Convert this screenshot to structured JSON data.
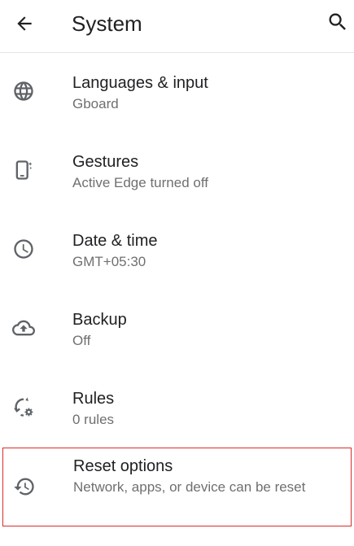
{
  "header": {
    "title": "System",
    "back_icon": "arrow-left-icon",
    "search_icon": "search-icon"
  },
  "items": [
    {
      "title": "Languages & input",
      "subtitle": "Gboard",
      "icon": "globe-icon"
    },
    {
      "title": "Gestures",
      "subtitle": "Active Edge turned off",
      "icon": "phone-gesture-icon"
    },
    {
      "title": "Date & time",
      "subtitle": "GMT+05:30",
      "icon": "clock-icon"
    },
    {
      "title": "Backup",
      "subtitle": "Off",
      "icon": "cloud-upload-icon"
    },
    {
      "title": "Rules",
      "subtitle": "0 rules",
      "icon": "rules-icon"
    },
    {
      "title": "Reset options",
      "subtitle": "Network, apps, or device can be reset",
      "icon": "history-icon"
    }
  ],
  "colors": {
    "highlight_border": "#d92b2b",
    "secondary_text": "#6f6f6f",
    "icon": "#5f6368"
  }
}
